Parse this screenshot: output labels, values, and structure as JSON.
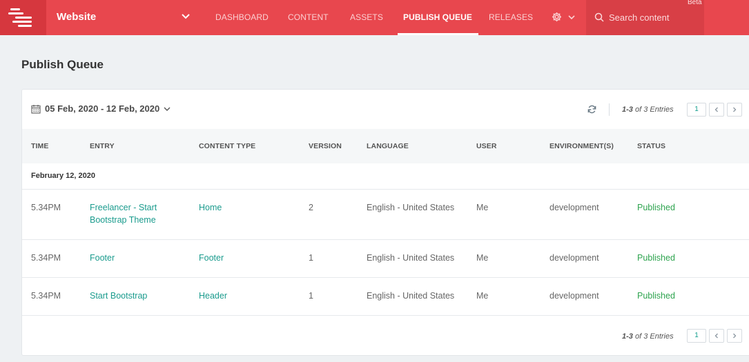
{
  "topbar": {
    "stack_name": "Website",
    "nav": [
      "DASHBOARD",
      "CONTENT",
      "ASSETS",
      "PUBLISH QUEUE",
      "RELEASES"
    ],
    "search_placeholder": "Search content",
    "beta_label": "Beta",
    "colors": {
      "bar": "#e8474e",
      "logo_bg": "#d6373e"
    }
  },
  "page": {
    "title": "Publish Queue"
  },
  "filter": {
    "date_range": "05 Feb, 2020 - 12 Feb, 2020"
  },
  "pagination": {
    "range": "1-3",
    "suffix": "of 3 Entries",
    "page": "1"
  },
  "table": {
    "headers": [
      "TIME",
      "ENTRY",
      "CONTENT TYPE",
      "VERSION",
      "LANGUAGE",
      "USER",
      "ENVIRONMENT(S)",
      "STATUS"
    ],
    "group_label": "February 12, 2020",
    "rows": [
      {
        "time": "5.34PM",
        "entry_line1": "Freelancer - Start",
        "entry_line2": "Bootstrap Theme",
        "content_type": "Home",
        "version": "2",
        "language": "English - United States",
        "user": "Me",
        "environment": "development",
        "status": "Published"
      },
      {
        "time": "5.34PM",
        "entry_line1": "Footer",
        "entry_line2": "",
        "content_type": "Footer",
        "version": "1",
        "language": "English - United States",
        "user": "Me",
        "environment": "development",
        "status": "Published"
      },
      {
        "time": "5.34PM",
        "entry_line1": "Start Bootstrap",
        "entry_line2": "",
        "content_type": "Header",
        "version": "1",
        "language": "English - United States",
        "user": "Me",
        "environment": "development",
        "status": "Published"
      }
    ],
    "colors": {
      "link": "#1a9b8d",
      "status_published": "#2ea44f"
    }
  },
  "icons": [
    "stack-logo-icon",
    "chevron-down-icon",
    "gear-icon",
    "search-icon",
    "calendar-icon",
    "refresh-icon",
    "chevron-left-icon",
    "chevron-right-icon"
  ]
}
